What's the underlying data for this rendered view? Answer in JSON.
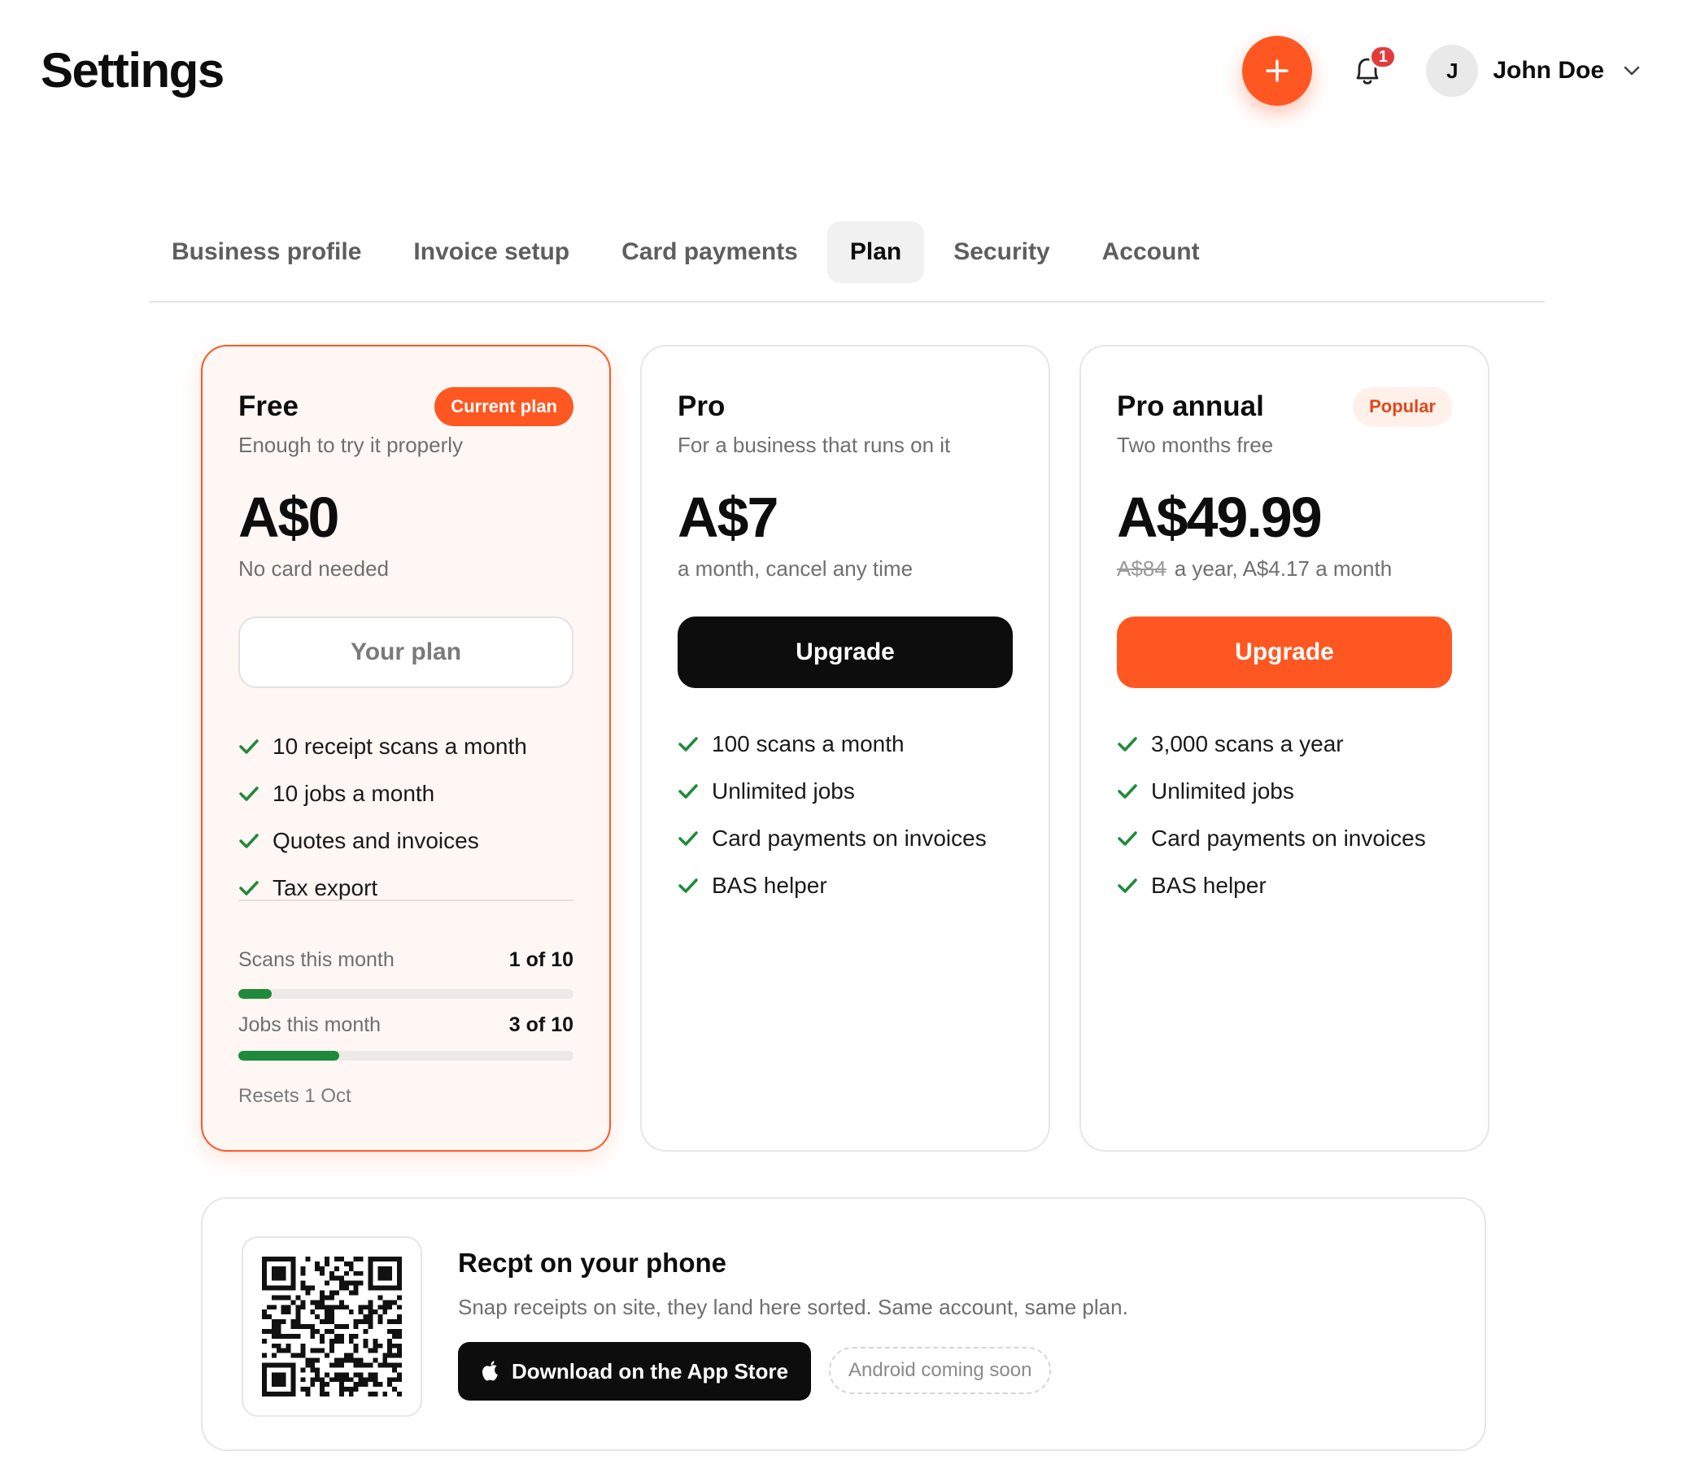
{
  "header": {
    "title": "Settings",
    "notification_count": "1",
    "user": {
      "initial": "J",
      "name": "John Doe"
    },
    "icons": {
      "add": "plus-icon",
      "bell": "bell-icon",
      "menu": "chevron-down-icon"
    }
  },
  "tabs": [
    {
      "label": "Business profile",
      "active": false
    },
    {
      "label": "Invoice setup",
      "active": false
    },
    {
      "label": "Card payments",
      "active": false
    },
    {
      "label": "Plan",
      "active": true
    },
    {
      "label": "Security",
      "active": false
    },
    {
      "label": "Account",
      "active": false
    }
  ],
  "plans": [
    {
      "name": "Free",
      "badge": "Current plan",
      "tagline": "Enough to try it properly",
      "price": "A$0",
      "price_note": "No card needed",
      "button": "Your plan",
      "features": [
        "10 receipt scans a month",
        "10 jobs a month",
        "Quotes and invoices",
        "Tax export"
      ],
      "usage": [
        {
          "label": "Scans this month",
          "value": "1 of 10",
          "fraction": 0.1
        },
        {
          "label": "Jobs this month",
          "value": "3 of 10",
          "fraction": 0.3
        }
      ],
      "resets": "Resets 1 Oct"
    },
    {
      "name": "Pro",
      "tagline": "For a business that runs on it",
      "price": "A$7",
      "price_note": "a month, cancel any time",
      "button": "Upgrade",
      "features": [
        "100 scans a month",
        "Unlimited jobs",
        "Card payments on invoices",
        "BAS helper"
      ]
    },
    {
      "name": "Pro annual",
      "badge": "Popular",
      "tagline": "Two months free",
      "price": "A$49.99",
      "price_old": "A$84",
      "price_note": "a year, A$4.17 a month",
      "button": "Upgrade",
      "features": [
        "3,000 scans a year",
        "Unlimited jobs",
        "Card payments on invoices",
        "BAS helper"
      ]
    }
  ],
  "promo": {
    "title": "Recpt on your phone",
    "text": "Snap receipts on site, they land here sorted. Same account, same plan.",
    "store_button": "Download on the App Store",
    "android": "Android coming soon"
  },
  "colors": {
    "accent": "#ff5722",
    "check": "#1f8a3b",
    "badge_red": "#e23b3b"
  }
}
